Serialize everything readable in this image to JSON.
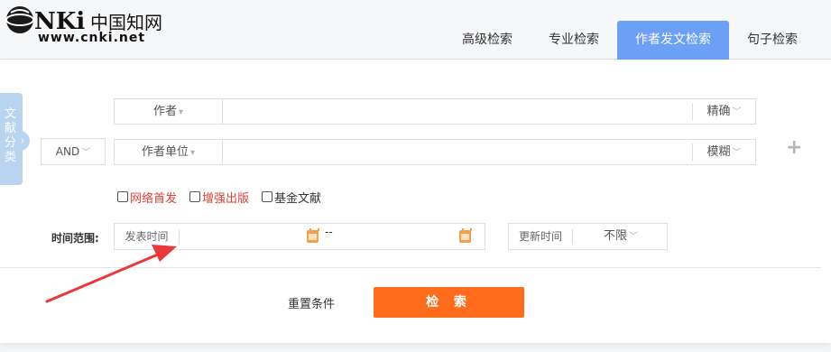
{
  "header": {
    "logo_text": "CNKi中国知网",
    "logo_url": "www.cnki.net",
    "tabs": [
      {
        "label": "高级检索",
        "active": false
      },
      {
        "label": "专业检索",
        "active": false
      },
      {
        "label": "作者发文检索",
        "active": true
      },
      {
        "label": "句子检索",
        "active": false
      }
    ]
  },
  "side_tab": {
    "label": [
      "文",
      "献",
      "分",
      "类"
    ],
    "icon": "chevron-right-icon"
  },
  "rows": [
    {
      "field": "作者",
      "match": "精确",
      "value": ""
    },
    {
      "logic": "AND",
      "field": "作者单位",
      "match": "模糊",
      "value": ""
    }
  ],
  "add_row_icon": "plus-icon",
  "checkboxes": [
    {
      "label": "网络首发",
      "checked": false,
      "color": "#e53d33"
    },
    {
      "label": "增强出版",
      "checked": false,
      "color": "#e53d33"
    },
    {
      "label": "基金文献",
      "checked": false,
      "color": "#333333"
    }
  ],
  "time": {
    "label": "时间范围:",
    "date_field_label": "发表时间",
    "separator": "--",
    "update_label": "更新时间",
    "update_value": "不限"
  },
  "actions": {
    "reset": "重置条件",
    "search": "检 索"
  },
  "colors": {
    "accent": "#6c9ff6",
    "search_button": "#ff6c1b",
    "annotation_arrow": "#e8393b"
  }
}
